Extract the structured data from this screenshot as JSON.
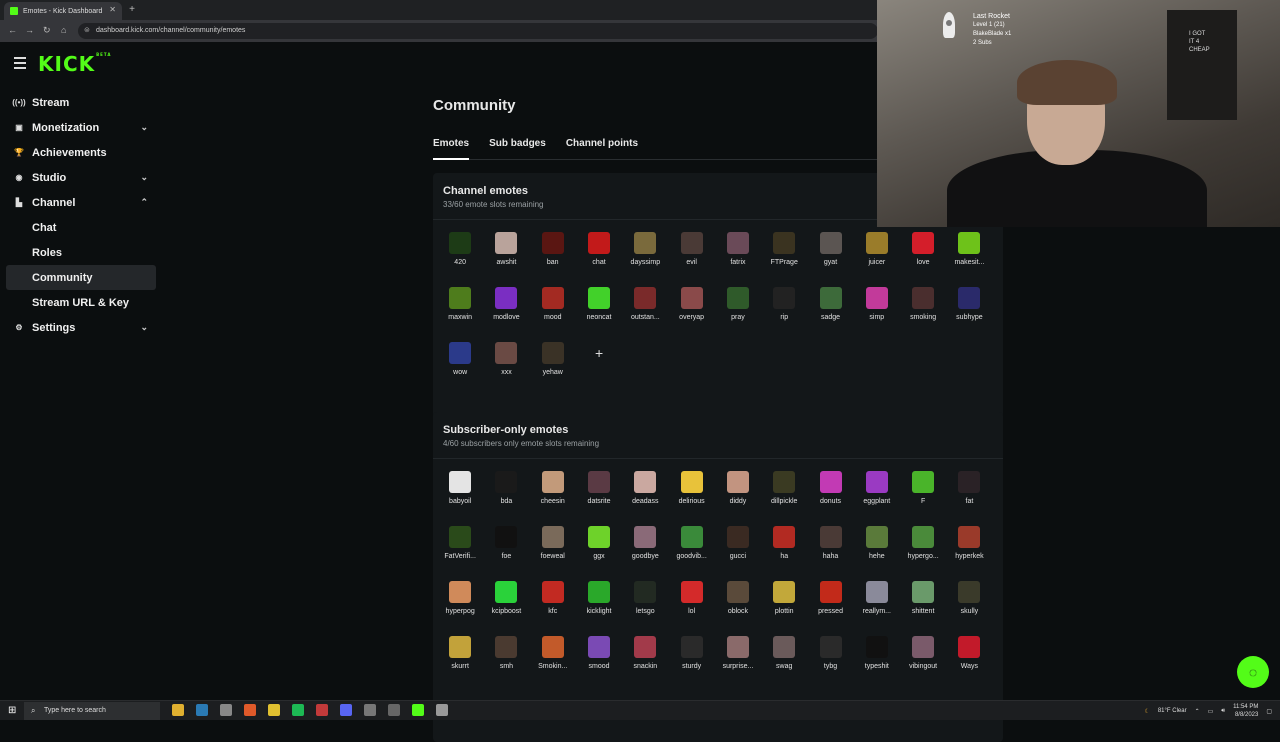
{
  "browser": {
    "tab_title": "Emotes - Kick Dashboard",
    "url": "dashboard.kick.com/channel/community/emotes"
  },
  "sidebar": {
    "logo": "KICK",
    "logo_badge": "BETA",
    "items": [
      {
        "label": "Stream",
        "icon": "stream-icon"
      },
      {
        "label": "Monetization",
        "icon": "monetization-icon"
      },
      {
        "label": "Achievements",
        "icon": "trophy-icon"
      },
      {
        "label": "Studio",
        "icon": "studio-icon"
      },
      {
        "label": "Channel",
        "icon": "channel-icon"
      },
      {
        "label": "Chat"
      },
      {
        "label": "Roles"
      },
      {
        "label": "Community"
      },
      {
        "label": "Stream URL & Key"
      },
      {
        "label": "Settings",
        "icon": "settings-icon"
      }
    ]
  },
  "main": {
    "title": "Community",
    "tabs": [
      {
        "label": "Emotes"
      },
      {
        "label": "Sub badges"
      },
      {
        "label": "Channel points"
      }
    ],
    "channel_emotes": {
      "title": "Channel emotes",
      "subtitle": "33/60 emote slots remaining",
      "emotes": [
        {
          "name": "420",
          "color": "#1d3b16"
        },
        {
          "name": "awshit",
          "color": "#b9a39b"
        },
        {
          "name": "ban",
          "color": "#5a1612"
        },
        {
          "name": "chat",
          "color": "#c21a1a"
        },
        {
          "name": "dayssimp",
          "color": "#7a6a3c"
        },
        {
          "name": "evil",
          "color": "#4a3a36"
        },
        {
          "name": "fatrix",
          "color": "#6a4a58"
        },
        {
          "name": "FTPrage",
          "color": "#3a3320"
        },
        {
          "name": "gyat",
          "color": "#5b5552"
        },
        {
          "name": "juicer",
          "color": "#9a7c2a"
        },
        {
          "name": "love",
          "color": "#d41e2a"
        },
        {
          "name": "makesit...",
          "color": "#6ec21a"
        },
        {
          "name": "maxwin",
          "color": "#4e7c1c"
        },
        {
          "name": "modlove",
          "color": "#7a2ec2"
        },
        {
          "name": "mood",
          "color": "#a32a22"
        },
        {
          "name": "neoncat",
          "color": "#42d12a"
        },
        {
          "name": "outstan...",
          "color": "#7a2a2a"
        },
        {
          "name": "overyap",
          "color": "#8a4a4a"
        },
        {
          "name": "pray",
          "color": "#2f5a2a"
        },
        {
          "name": "rip",
          "color": "#222222"
        },
        {
          "name": "sadge",
          "color": "#3d6a3a"
        },
        {
          "name": "simp",
          "color": "#c23a9a"
        },
        {
          "name": "smoking",
          "color": "#4a2e2e"
        },
        {
          "name": "subhype",
          "color": "#2a2a6a"
        },
        {
          "name": "wow",
          "color": "#2b3a8a"
        },
        {
          "name": "xxx",
          "color": "#6a4a44"
        },
        {
          "name": "yehaw",
          "color": "#3a3226"
        }
      ]
    },
    "sub_emotes": {
      "title": "Subscriber-only emotes",
      "subtitle": "4/60 subscribers only emote slots remaining",
      "emotes": [
        {
          "name": "babyoil",
          "color": "#e4e4e4"
        },
        {
          "name": "bda",
          "color": "#1a1a1a"
        },
        {
          "name": "cheesin",
          "color": "#c29a7a"
        },
        {
          "name": "datsrite",
          "color": "#5a3a44"
        },
        {
          "name": "deadass",
          "color": "#caa8a0"
        },
        {
          "name": "delirious",
          "color": "#e8c23a"
        },
        {
          "name": "diddy",
          "color": "#c29480"
        },
        {
          "name": "dillpickle",
          "color": "#3a3a22"
        },
        {
          "name": "donuts",
          "color": "#c23ab4"
        },
        {
          "name": "eggplant",
          "color": "#9a3ac2"
        },
        {
          "name": "F",
          "color": "#4ab42a"
        },
        {
          "name": "fat",
          "color": "#2a2226"
        },
        {
          "name": "FatVerifi...",
          "color": "#2a4a1a"
        },
        {
          "name": "foe",
          "color": "#111111"
        },
        {
          "name": "foeweal",
          "color": "#7a6a5a"
        },
        {
          "name": "ggx",
          "color": "#6ed22a"
        },
        {
          "name": "goodbye",
          "color": "#8a6a78"
        },
        {
          "name": "goodvib...",
          "color": "#3a8a3a"
        },
        {
          "name": "gucci",
          "color": "#3a2a22"
        },
        {
          "name": "ha",
          "color": "#b22a22"
        },
        {
          "name": "haha",
          "color": "#4a3a36"
        },
        {
          "name": "hehe",
          "color": "#5a7a3a"
        },
        {
          "name": "hypergo...",
          "color": "#4a8a3a"
        },
        {
          "name": "hyperkek",
          "color": "#9a3a2a"
        },
        {
          "name": "hyperpog",
          "color": "#d08a5a"
        },
        {
          "name": "kcipboost",
          "color": "#2ad23a"
        },
        {
          "name": "kfc",
          "color": "#c22a22"
        },
        {
          "name": "kicklight",
          "color": "#2aa82a"
        },
        {
          "name": "letsgo",
          "color": "#222a22"
        },
        {
          "name": "lol",
          "color": "#d42a2a"
        },
        {
          "name": "oblock",
          "color": "#5a4a3a"
        },
        {
          "name": "plottin",
          "color": "#c2a83a"
        },
        {
          "name": "pressed",
          "color": "#c22a1a"
        },
        {
          "name": "reallym...",
          "color": "#8a8a9a"
        },
        {
          "name": "shittent",
          "color": "#6a9a6a"
        },
        {
          "name": "skully",
          "color": "#3a3a2a"
        },
        {
          "name": "skurrt",
          "color": "#c2a23a"
        },
        {
          "name": "smh",
          "color": "#4a3a30"
        },
        {
          "name": "Smokin...",
          "color": "#c25a2a"
        },
        {
          "name": "smood",
          "color": "#7a4ab4"
        },
        {
          "name": "snackin",
          "color": "#a23a4a"
        },
        {
          "name": "sturdy",
          "color": "#2a2a2a"
        },
        {
          "name": "surprise...",
          "color": "#8a6a6a"
        },
        {
          "name": "swag",
          "color": "#6a5a5a"
        },
        {
          "name": "tybg",
          "color": "#2a2a2a"
        },
        {
          "name": "typeshit",
          "color": "#111111"
        },
        {
          "name": "vibingout",
          "color": "#7a5a6a"
        },
        {
          "name": "Ways",
          "color": "#c21a2a"
        }
      ]
    }
  },
  "overlay": {
    "alert_title": "Last Rocket",
    "alert_level": "Level 1  (21)",
    "alert_user": "BlakeBlade x1",
    "alert_subs": "2 Subs",
    "shirt_text": "I GOT\nIT 4\nCHEAP"
  },
  "taskbar": {
    "search_placeholder": "Type here to search",
    "weather": "81°F  Clear",
    "time": "11:54 PM",
    "date": "8/8/2023"
  },
  "colors": {
    "accent": "#53fc18",
    "background": "#0b0e0f",
    "panel": "#131719"
  }
}
